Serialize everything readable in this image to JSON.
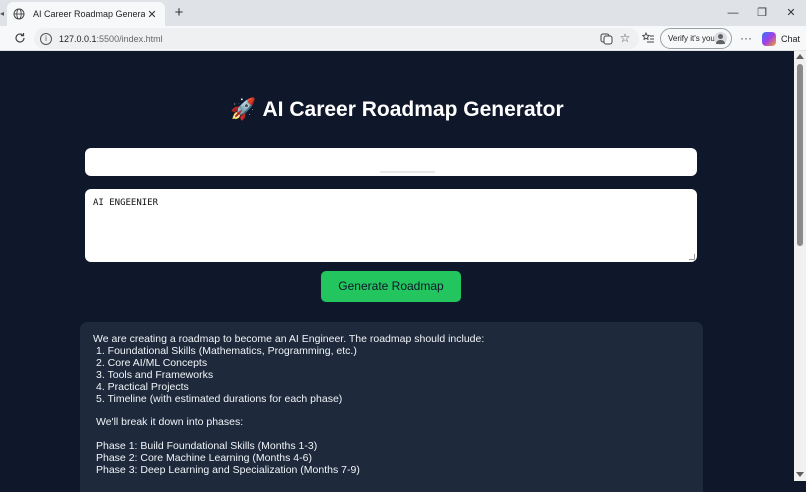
{
  "browser": {
    "tab_title": "AI Career Roadmap Generator",
    "tab_close": "✕",
    "new_tab": "+",
    "url_host": "127.0.0.1",
    "url_path": ":5500/index.html",
    "verify_label": "Verify it's you",
    "chat_label": "Chat",
    "more": "···",
    "minimize": "—",
    "restore": "❐",
    "close": "✕"
  },
  "page": {
    "rocket": "🚀",
    "title": "AI Career Roadmap Generator",
    "api_key_value": "",
    "prompt_value": "AI ENGEENIER",
    "generate_label": "Generate Roadmap"
  },
  "output": {
    "intro": "We are creating a roadmap to become an AI Engineer. The roadmap should include:",
    "items": [
      "1. Foundational Skills (Mathematics, Programming, etc.)",
      "2. Core AI/ML Concepts",
      "3. Tools and Frameworks",
      "4. Practical Projects",
      "5. Timeline (with estimated durations for each phase)"
    ],
    "phases_intro": "We'll break it down into phases:",
    "phases": [
      "Phase 1: Build Foundational Skills (Months 1-3)",
      "Phase 2: Core Machine Learning (Months 4-6)",
      "Phase 3: Deep Learning and Specialization (Months 7-9)"
    ]
  },
  "colors": {
    "page_bg": "#0f172a",
    "panel_bg": "#1e293b",
    "accent_green": "#22c55e"
  }
}
